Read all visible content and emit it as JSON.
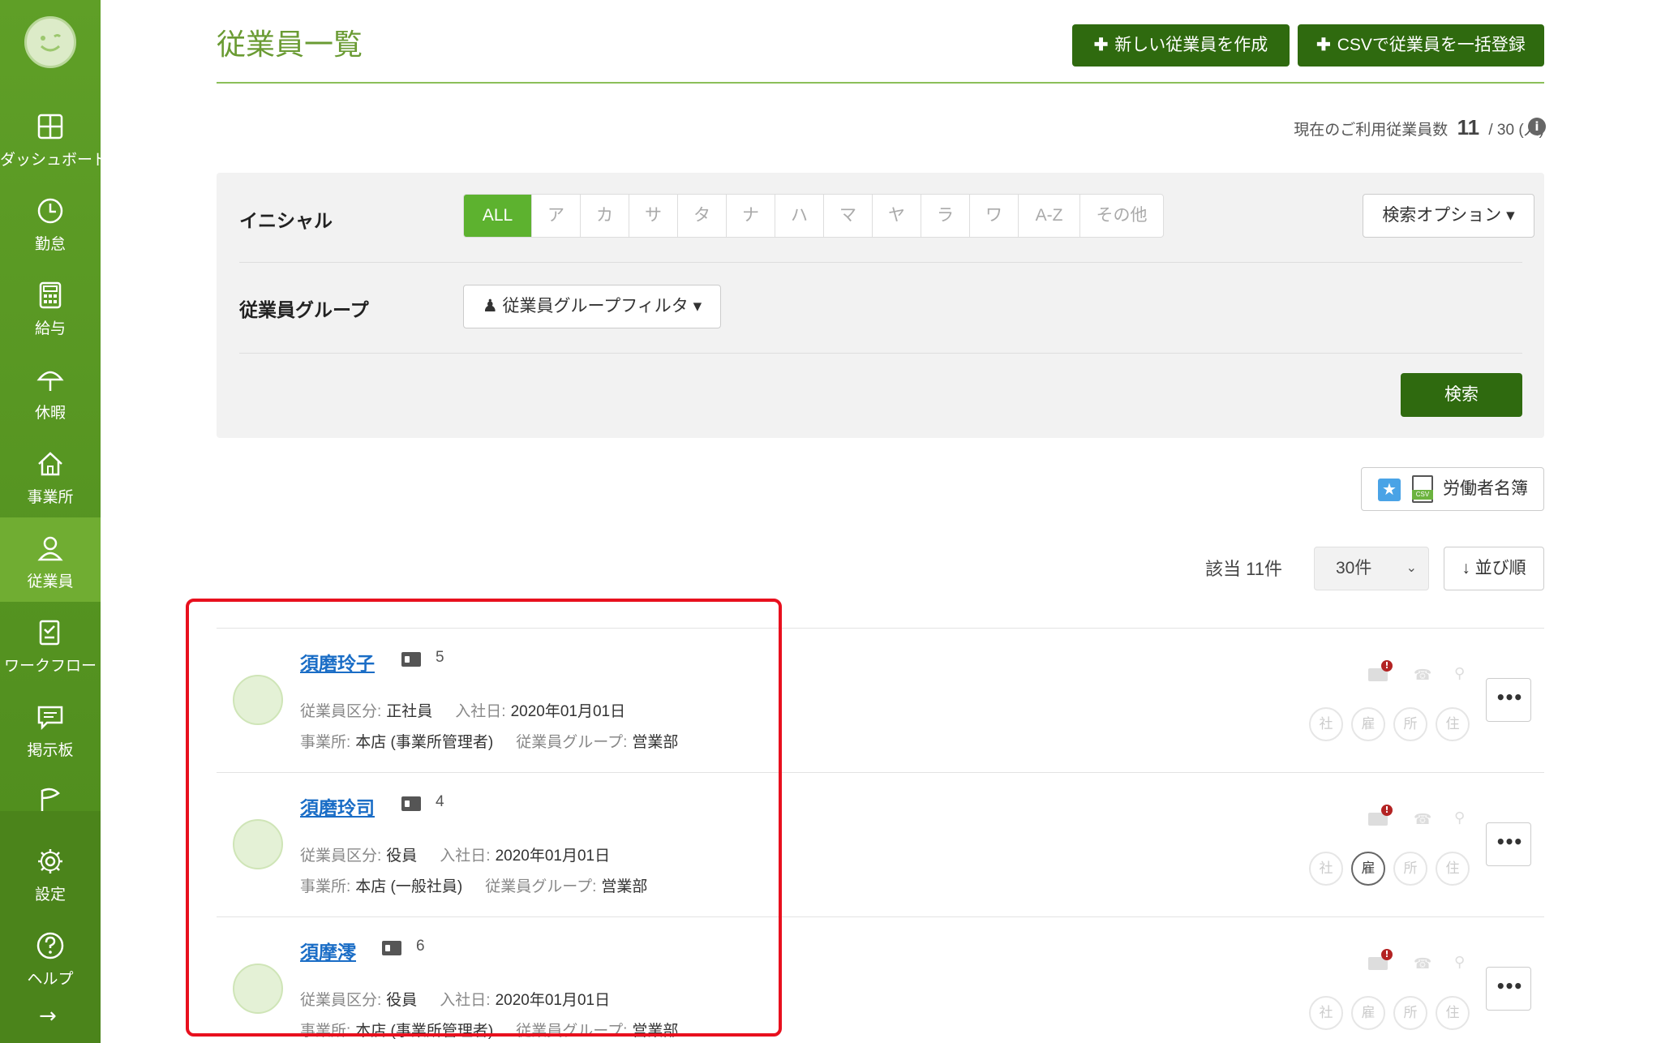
{
  "sidebar": {
    "items": [
      {
        "label": "ダッシュボード",
        "icon": "dashboard-icon"
      },
      {
        "label": "勤怠",
        "icon": "clock-icon"
      },
      {
        "label": "給与",
        "icon": "calculator-icon"
      },
      {
        "label": "休暇",
        "icon": "umbrella-icon"
      },
      {
        "label": "事業所",
        "icon": "home-icon"
      },
      {
        "label": "従業員",
        "icon": "user-icon"
      },
      {
        "label": "ワークフロー",
        "icon": "workflow-icon"
      },
      {
        "label": "掲示板",
        "icon": "message-icon"
      },
      {
        "label": "",
        "icon": "flag-icon"
      },
      {
        "label": "設定",
        "icon": "gear-icon"
      },
      {
        "label": "ヘルプ",
        "icon": "help-icon"
      }
    ],
    "expand_icon": "→"
  },
  "header": {
    "title": "従業員一覧",
    "new_button": "新しい従業員を作成",
    "csv_button": "CSVで従業員を一括登録",
    "plus": "✚"
  },
  "usage": {
    "label": "現在のご利用従業員数",
    "current": "11",
    "total": "/ 30 (人)"
  },
  "filter": {
    "initial_label": "イニシャル",
    "initials": [
      "ALL",
      "ア",
      "カ",
      "サ",
      "タ",
      "ナ",
      "ハ",
      "マ",
      "ヤ",
      "ラ",
      "ワ",
      "A-Z",
      "その他"
    ],
    "search_options": "検索オプション ▾",
    "group_label": "従業員グループ",
    "group_filter": "従業員グループフィルタ ▾",
    "search_button": "検索"
  },
  "roster_button": "労働者名簿",
  "list": {
    "count": "該当 11件",
    "per_page": "30件",
    "sort": "並び順"
  },
  "employees": [
    {
      "name": "須磨玲子",
      "num": "5",
      "type_label": "従業員区分:",
      "type": "正社員",
      "join_label": "入社日:",
      "join": "2020年01月01日",
      "office_label": "事業所:",
      "office": "本店 (事業所管理者)",
      "group_label": "従業員グループ:",
      "group": "営業部",
      "badges": [
        "社",
        "雇",
        "所",
        "住"
      ],
      "active_badge": -1
    },
    {
      "name": "須磨玲司",
      "num": "4",
      "type_label": "従業員区分:",
      "type": "役員",
      "join_label": "入社日:",
      "join": "2020年01月01日",
      "office_label": "事業所:",
      "office": "本店 (一般社員)",
      "group_label": "従業員グループ:",
      "group": "営業部",
      "badges": [
        "社",
        "雇",
        "所",
        "住"
      ],
      "active_badge": 1
    },
    {
      "name": "須摩澪",
      "num": "6",
      "type_label": "従業員区分:",
      "type": "役員",
      "join_label": "入社日:",
      "join": "2020年01月01日",
      "office_label": "事業所:",
      "office": "本店 (事業所管理者)",
      "group_label": "従業員グループ:",
      "group": "営業部",
      "badges": [
        "社",
        "雇",
        "所",
        "住"
      ],
      "active_badge": -1
    }
  ],
  "more_label": "•••",
  "colors": {
    "sidebar": "#5f9f27",
    "primary_button": "#2f6a0f",
    "accent": "#5db22f",
    "link": "#1a6dc6",
    "highlight": "#e8101e"
  }
}
